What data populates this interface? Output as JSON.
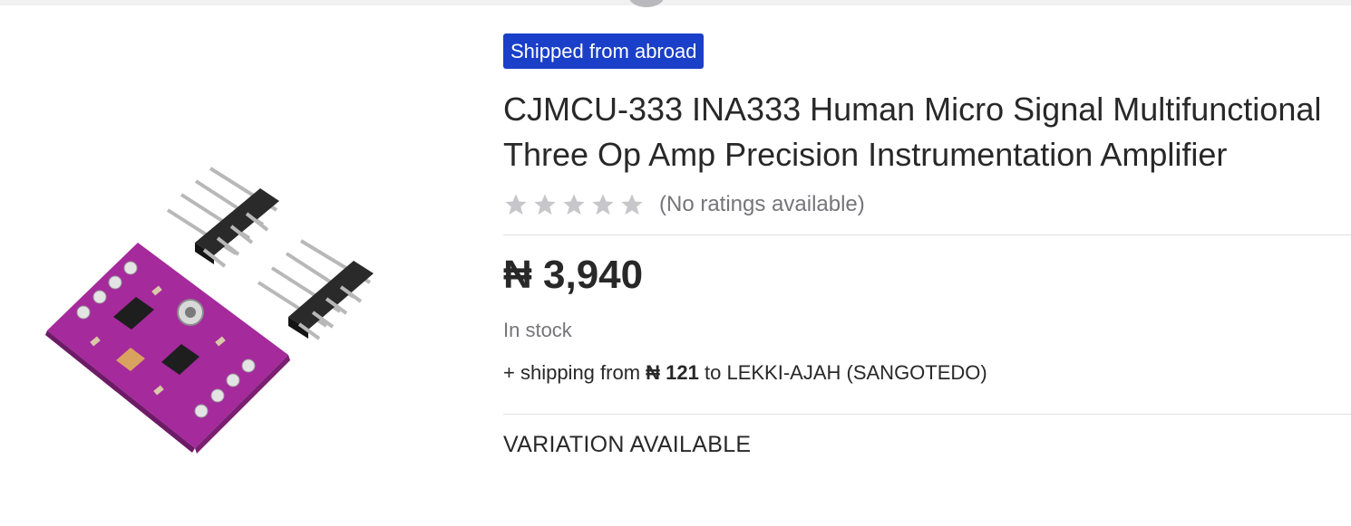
{
  "badge": "Shipped from abroad",
  "product": {
    "title": "CJMCU-333 INA333 Human Micro Signal Multifunctional Three Op Amp Precision Instrumentation Amplifier",
    "rating_text": "(No ratings available)",
    "rating_value": 0,
    "rating_max": 5,
    "price": "₦ 3,940",
    "stock": "In stock",
    "shipping_prefix": "+ shipping from",
    "shipping_price": "₦ 121",
    "shipping_suffix": "to LEKKI-AJAH (SANGOTEDO)"
  },
  "variation_label": "VARIATION AVAILABLE",
  "colors": {
    "badge": "#1a3fc8",
    "board": "#a52a9c",
    "star_empty": "#c7c7cb"
  }
}
